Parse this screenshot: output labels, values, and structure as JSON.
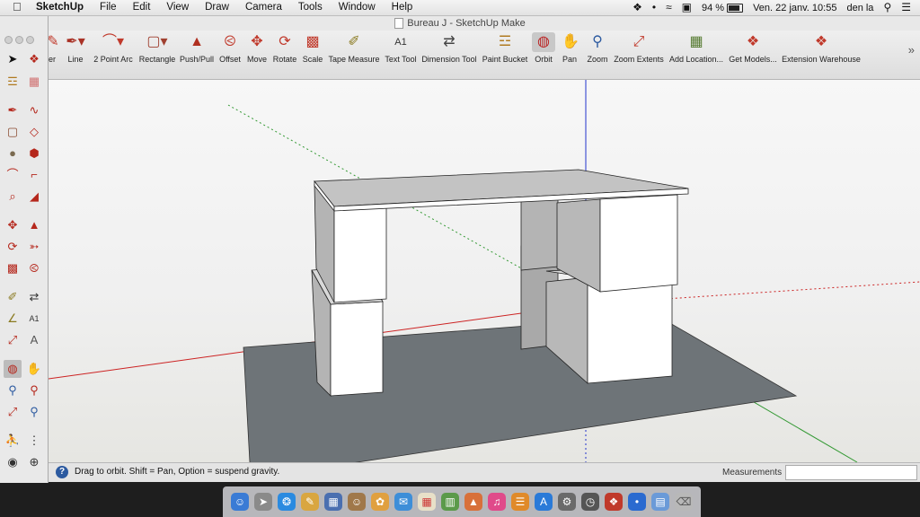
{
  "menubar": {
    "apple_icon": "apple-icon",
    "app_name": "SketchUp",
    "items": [
      "File",
      "Edit",
      "View",
      "Draw",
      "Camera",
      "Tools",
      "Window",
      "Help"
    ],
    "battery": "94 %",
    "datetime": "Ven. 22 janv. 10:55",
    "user": "den la"
  },
  "window": {
    "title": "Bureau J - SketchUp Make"
  },
  "toolbar": {
    "tools": [
      {
        "label": "er",
        "icon": "eraser-icon"
      },
      {
        "label": "Line",
        "icon": "pencil-icon"
      },
      {
        "label": "2 Point Arc",
        "icon": "arc-icon"
      },
      {
        "label": "Rectangle",
        "icon": "rectangle-icon"
      },
      {
        "label": "Push/Pull",
        "icon": "push-pull-icon"
      },
      {
        "label": "Offset",
        "icon": "offset-icon"
      },
      {
        "label": "Move",
        "icon": "move-icon"
      },
      {
        "label": "Rotate",
        "icon": "rotate-icon"
      },
      {
        "label": "Scale",
        "icon": "scale-icon"
      },
      {
        "label": "Tape Measure",
        "icon": "tape-measure-icon"
      },
      {
        "label": "Text Tool",
        "icon": "text-tool-icon"
      },
      {
        "label": "Dimension Tool",
        "icon": "dimension-icon"
      },
      {
        "label": "Paint Bucket",
        "icon": "paint-bucket-icon"
      },
      {
        "label": "Orbit",
        "icon": "orbit-icon"
      },
      {
        "label": "Pan",
        "icon": "pan-icon"
      },
      {
        "label": "Zoom",
        "icon": "zoom-icon"
      },
      {
        "label": "Zoom Extents",
        "icon": "zoom-extents-icon"
      },
      {
        "label": "Add Location...",
        "icon": "add-location-icon"
      },
      {
        "label": "Get Models...",
        "icon": "get-models-icon"
      },
      {
        "label": "Extension Warehouse",
        "icon": "extension-warehouse-icon"
      }
    ],
    "active_tool": "Orbit",
    "overflow": "»"
  },
  "statusbar": {
    "help_icon": "?",
    "message": "Drag to orbit. Shift = Pan, Option = suspend gravity.",
    "measurements_label": "Measurements",
    "measurements_value": ""
  }
}
